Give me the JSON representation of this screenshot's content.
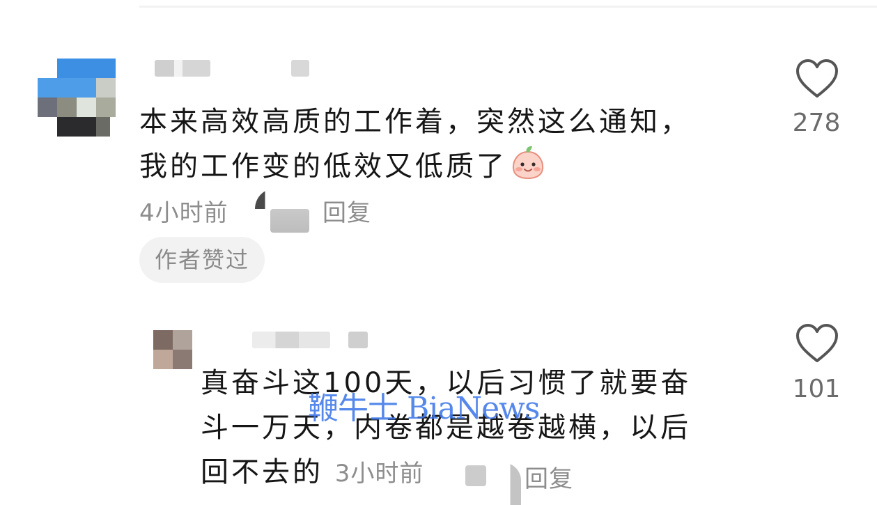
{
  "comments": [
    {
      "text_line1": "本来高效高质的工作着，突然这么通知，",
      "text_line2": "我的工作变的低效又低质了",
      "emoji": "blushing-face-emoji",
      "time": "4小时前",
      "reply_label": "回复",
      "author_liked_badge": "作者赞过",
      "likes": "278"
    },
    {
      "text_line1": "真奋斗这100天，以后习惯了就要奋",
      "text_line2": "斗一万天，内卷都是越卷越横，以后",
      "text_line3": "回不去的",
      "time": "3小时前",
      "reply_label": "回复",
      "likes": "101"
    }
  ],
  "watermark": "鞭牛士 BiaNews",
  "colors": {
    "text": "#161616",
    "meta": "#8d8d8d",
    "badge_bg": "#f2f2f2",
    "watermark": "#3e78e8",
    "heart_outline": "#555555"
  }
}
